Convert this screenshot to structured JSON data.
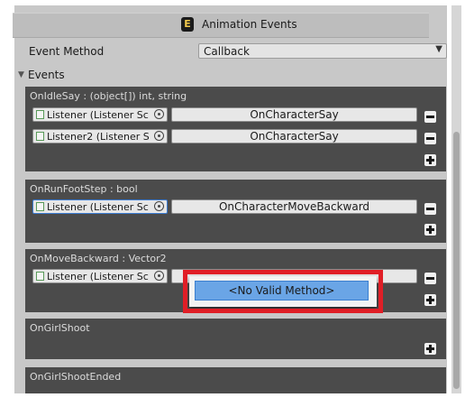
{
  "component": {
    "title": "Animation Events",
    "icon": "script-icon"
  },
  "event_method": {
    "label": "Event Method",
    "value": "Callback"
  },
  "events_foldout": {
    "label": "Events"
  },
  "events": [
    {
      "signature": "OnIdleSay : (object[]) int, string",
      "listeners": [
        {
          "object": "Listener (Listener Sc",
          "method": "OnCharacterSay"
        },
        {
          "object": "Listener2 (Listener S",
          "method": "OnCharacterSay"
        }
      ]
    },
    {
      "signature": "OnRunFootStep : bool",
      "listeners": [
        {
          "object": "Listener (Listener Sc",
          "method": "OnCharacterMoveBackward"
        }
      ]
    },
    {
      "signature": "OnMoveBackward : Vector2",
      "listeners": [
        {
          "object": "Listener (Listener Sc",
          "method": ""
        }
      ]
    },
    {
      "signature": "OnGirlShoot",
      "listeners": []
    },
    {
      "signature": "OnGirlShootEnded",
      "listeners": []
    }
  ],
  "popup": {
    "item": "<No Valid Method>"
  },
  "colors": {
    "highlight": "#e01e26",
    "popup_selected": "#6aa5e6",
    "event_background": "#4b4b4b"
  }
}
